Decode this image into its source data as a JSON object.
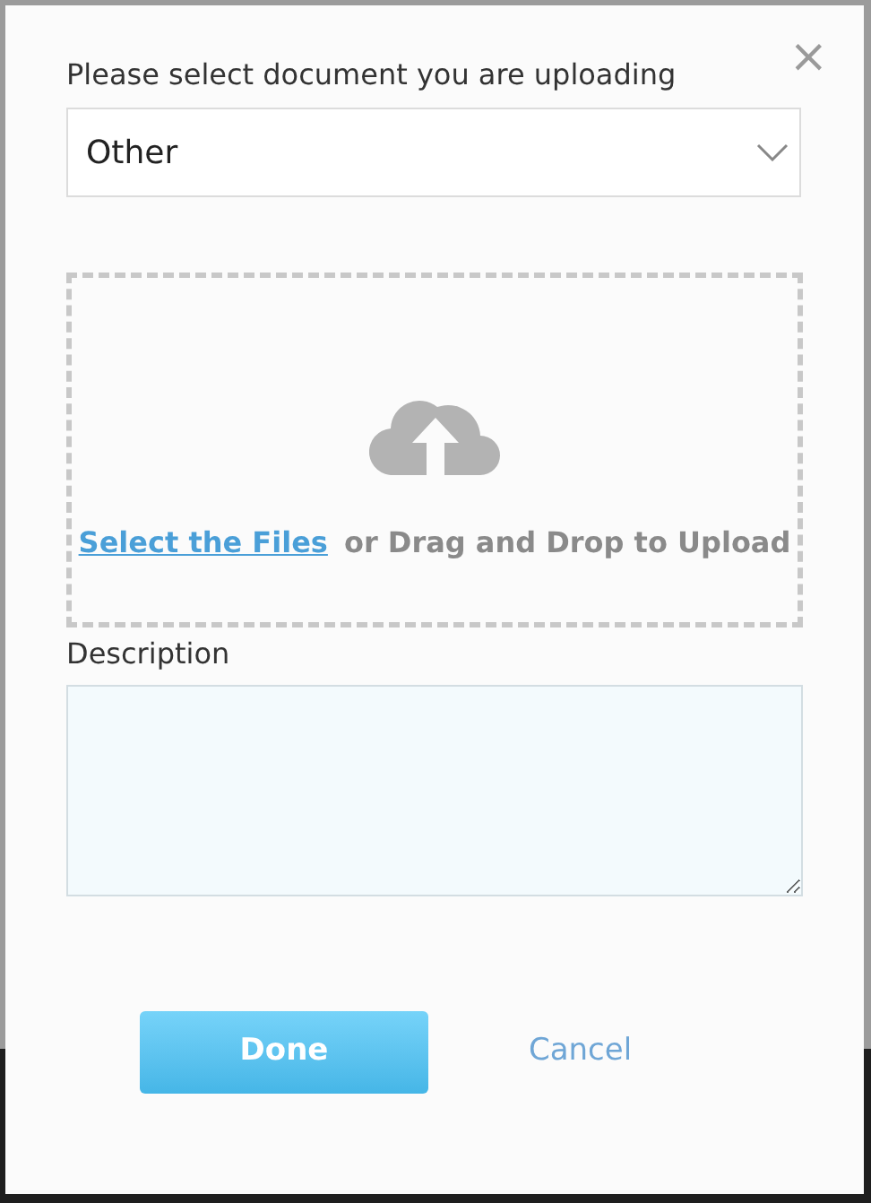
{
  "dialog": {
    "close_label": "×",
    "document_type": {
      "label": "Please select document you are uploading",
      "value": "Other"
    },
    "upload": {
      "link": "Select the Files",
      "text": "or Drag and Drop to Upload"
    },
    "description": {
      "label": "Description"
    },
    "buttons": [
      {
        "kind": "primary",
        "label": "Done"
      },
      {
        "kind": "link",
        "label": "Cancel"
      }
    ]
  }
}
